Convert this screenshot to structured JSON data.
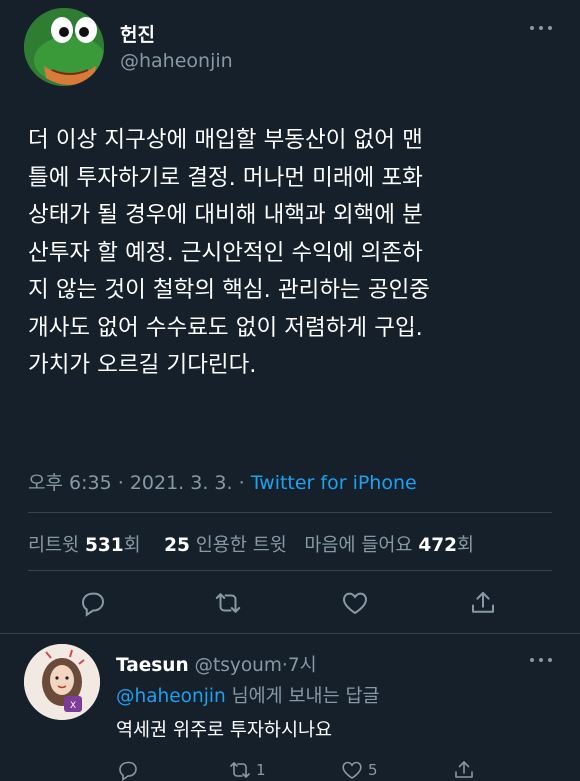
{
  "tweet": {
    "author_name": "헌진",
    "author_handle": "@haheonjin",
    "text_lines": [
      "더 이상 지구상에 매입할 부동산이 없어 맨",
      "틀에 투자하기로 결정. 머나먼 미래에 포화",
      "상태가 될 경우에 대비해 내핵과 외핵에 분",
      "산투자 할 예정. 근시안적인 수익에 의존하",
      "지 않는 것이 철학의 핵심. 관리하는 공인중",
      "개사도 없어 수수료도 없이 저렴하게 구입.",
      "가치가 오르길 기다린다."
    ],
    "time": "오후 6:35",
    "date": "2021. 3. 3.",
    "separator": "·",
    "source": "Twitter for iPhone",
    "stats": {
      "retweets_label": "리트윗",
      "retweets_count": "531",
      "retweets_suffix": "회",
      "quotes_count": "25",
      "quotes_label": "인용한 트윗",
      "likes_label": "마음에 들어요",
      "likes_count": "472",
      "likes_suffix": "회"
    },
    "actions": [
      "reply",
      "retweet",
      "like",
      "share"
    ]
  },
  "reply": {
    "author_name": "Taesun",
    "author_handle": "@tsyoum",
    "dot": "·",
    "time": "7시",
    "replying_to_mention": "@haheonjin",
    "replying_to_suffix": " 님에게 보내는 답글",
    "text": "역세권 위주로 투자하시나요",
    "retweet_count": "1",
    "like_count": "5"
  },
  "colors": {
    "background": "#15202b",
    "text_primary": "#ffffff",
    "text_secondary": "#8899a6",
    "link": "#1da1f2",
    "divider": "#38444d"
  }
}
